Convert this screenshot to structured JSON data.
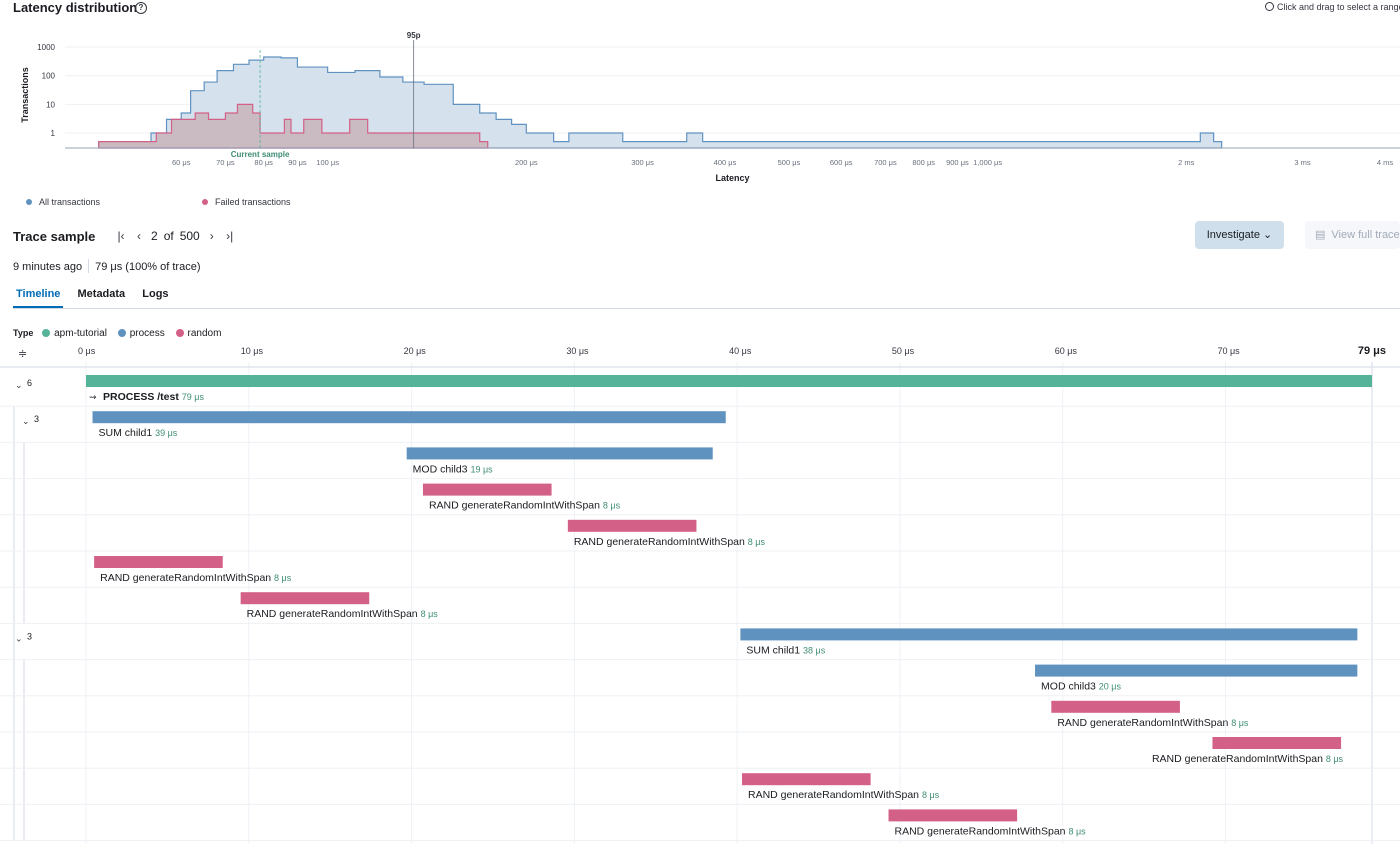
{
  "header": {
    "title": "Latency distribution",
    "help_icon": "?",
    "drag_hint": "Click and drag to select a range"
  },
  "histogram": {
    "y_axis_label": "Transactions",
    "x_axis_label": "Latency",
    "y_ticks": [
      "1000",
      "100",
      "10",
      "1"
    ],
    "x_ticks": [
      "60 μs",
      "70 μs",
      "80 μs",
      "90 μs",
      "100 μs",
      "200 μs",
      "300 μs",
      "400 μs",
      "500 μs",
      "600 μs",
      "700 μs",
      "800 μs",
      "900 μs",
      "1,000 μs",
      "2 ms",
      "3 ms",
      "4 ms"
    ],
    "percentile_label": "95p",
    "current_sample_label": "Current sample",
    "colors": {
      "all": "#6092c0",
      "all_fill": "#d5e2ee",
      "failed": "#d36086",
      "failed_fill": "#c8b3b8"
    }
  },
  "chart_data": {
    "type": "area",
    "title": "Latency distribution",
    "xlabel": "Latency",
    "ylabel": "Transactions",
    "x_scale": "log",
    "y_scale": "log",
    "x_unit": "μs",
    "xlim": [
      40,
      4000
    ],
    "ylim": [
      0.3,
      1500
    ],
    "percentile_95_us": 135,
    "current_sample_us": 79,
    "series": [
      {
        "name": "All transactions",
        "points": [
          [
            45,
            0.5
          ],
          [
            54,
            1
          ],
          [
            57,
            3
          ],
          [
            60,
            5
          ],
          [
            62,
            30
          ],
          [
            65,
            60
          ],
          [
            68,
            150
          ],
          [
            72,
            250
          ],
          [
            76,
            350
          ],
          [
            80,
            450
          ],
          [
            85,
            420
          ],
          [
            90,
            200
          ],
          [
            100,
            130
          ],
          [
            110,
            150
          ],
          [
            120,
            90
          ],
          [
            130,
            60
          ],
          [
            140,
            50
          ],
          [
            155,
            10
          ],
          [
            170,
            5
          ],
          [
            180,
            3
          ],
          [
            190,
            2
          ],
          [
            200,
            1
          ],
          [
            220,
            0.5
          ],
          [
            232,
            1
          ],
          [
            280,
            0.5
          ],
          [
            350,
            1
          ],
          [
            370,
            0.5
          ],
          [
            2100,
            1
          ],
          [
            2200,
            0.5
          ]
        ]
      },
      {
        "name": "Failed transactions",
        "points": [
          [
            45,
            0.5
          ],
          [
            55,
            1
          ],
          [
            58,
            3
          ],
          [
            63,
            5
          ],
          [
            66,
            3
          ],
          [
            70,
            5
          ],
          [
            73,
            10
          ],
          [
            77,
            5
          ],
          [
            79,
            1
          ],
          [
            83,
            1
          ],
          [
            86,
            3
          ],
          [
            88,
            1
          ],
          [
            92,
            3
          ],
          [
            98,
            1
          ],
          [
            108,
            3
          ],
          [
            115,
            1
          ],
          [
            120,
            1
          ],
          [
            128,
            1
          ],
          [
            133,
            1
          ],
          [
            160,
            1
          ],
          [
            170,
            0.5
          ]
        ]
      }
    ]
  },
  "legend": {
    "all": "All transactions",
    "failed": "Failed transactions"
  },
  "trace_sample": {
    "title": "Trace sample",
    "current": "2",
    "of": "of",
    "total": "500",
    "investigate_label": "Investigate",
    "view_full_trace_label": "View full trace",
    "time_ago": "9 minutes ago",
    "duration": "79 μs (100% of trace)"
  },
  "tabs": [
    {
      "label": "Timeline",
      "active": true
    },
    {
      "label": "Metadata",
      "active": false
    },
    {
      "label": "Logs",
      "active": false
    }
  ],
  "type_legend": {
    "label": "Type",
    "items": [
      {
        "name": "apm-tutorial",
        "color": "#54b399"
      },
      {
        "name": "process",
        "color": "#6092c0"
      },
      {
        "name": "random",
        "color": "#d36086"
      }
    ]
  },
  "timeline": {
    "axis_ticks": [
      "0 μs",
      "10 μs",
      "20 μs",
      "30 μs",
      "40 μs",
      "50 μs",
      "60 μs",
      "70 μs"
    ],
    "axis_end": "79 μs",
    "total_us": 79,
    "groups": [
      {
        "count": "6",
        "row": 0
      },
      {
        "count": "3",
        "row": 1
      },
      {
        "count": "3",
        "row": 7
      }
    ],
    "rows": [
      {
        "start": 0,
        "duration": 79,
        "type": "apm-tutorial",
        "name": "PROCESS /test",
        "label": "79 μs",
        "bold": true,
        "icon": "transaction-icon"
      },
      {
        "start": 0.4,
        "duration": 38.9,
        "type": "process",
        "name": "SUM child1",
        "label": "39 μs"
      },
      {
        "start": 19.7,
        "duration": 18.8,
        "type": "process",
        "name": "MOD child3",
        "label": "19 μs"
      },
      {
        "start": 20.7,
        "duration": 7.9,
        "type": "random",
        "name": "RAND generateRandomIntWithSpan",
        "label": "8 μs"
      },
      {
        "start": 29.6,
        "duration": 7.9,
        "type": "random",
        "name": "RAND generateRandomIntWithSpan",
        "label": "8 μs"
      },
      {
        "start": 0.5,
        "duration": 7.9,
        "type": "random",
        "name": "RAND generateRandomIntWithSpan",
        "label": "8 μs"
      },
      {
        "start": 9.5,
        "duration": 7.9,
        "type": "random",
        "name": "RAND generateRandomIntWithSpan",
        "label": "8 μs"
      },
      {
        "start": 40.2,
        "duration": 37.9,
        "type": "process",
        "name": "SUM child1",
        "label": "38 μs"
      },
      {
        "start": 58.3,
        "duration": 19.8,
        "type": "process",
        "name": "MOD child3",
        "label": "20 μs"
      },
      {
        "start": 59.3,
        "duration": 7.9,
        "type": "random",
        "name": "RAND generateRandomIntWithSpan",
        "label": "8 μs"
      },
      {
        "start": 69.2,
        "duration": 7.9,
        "type": "random",
        "name": "RAND generateRandomIntWithSpan",
        "label": "8 μs"
      },
      {
        "start": 40.3,
        "duration": 7.9,
        "type": "random",
        "name": "RAND generateRandomIntWithSpan",
        "label": "8 μs"
      },
      {
        "start": 49.3,
        "duration": 7.9,
        "type": "random",
        "name": "RAND generateRandomIntWithSpan",
        "label": "8 μs"
      }
    ]
  }
}
